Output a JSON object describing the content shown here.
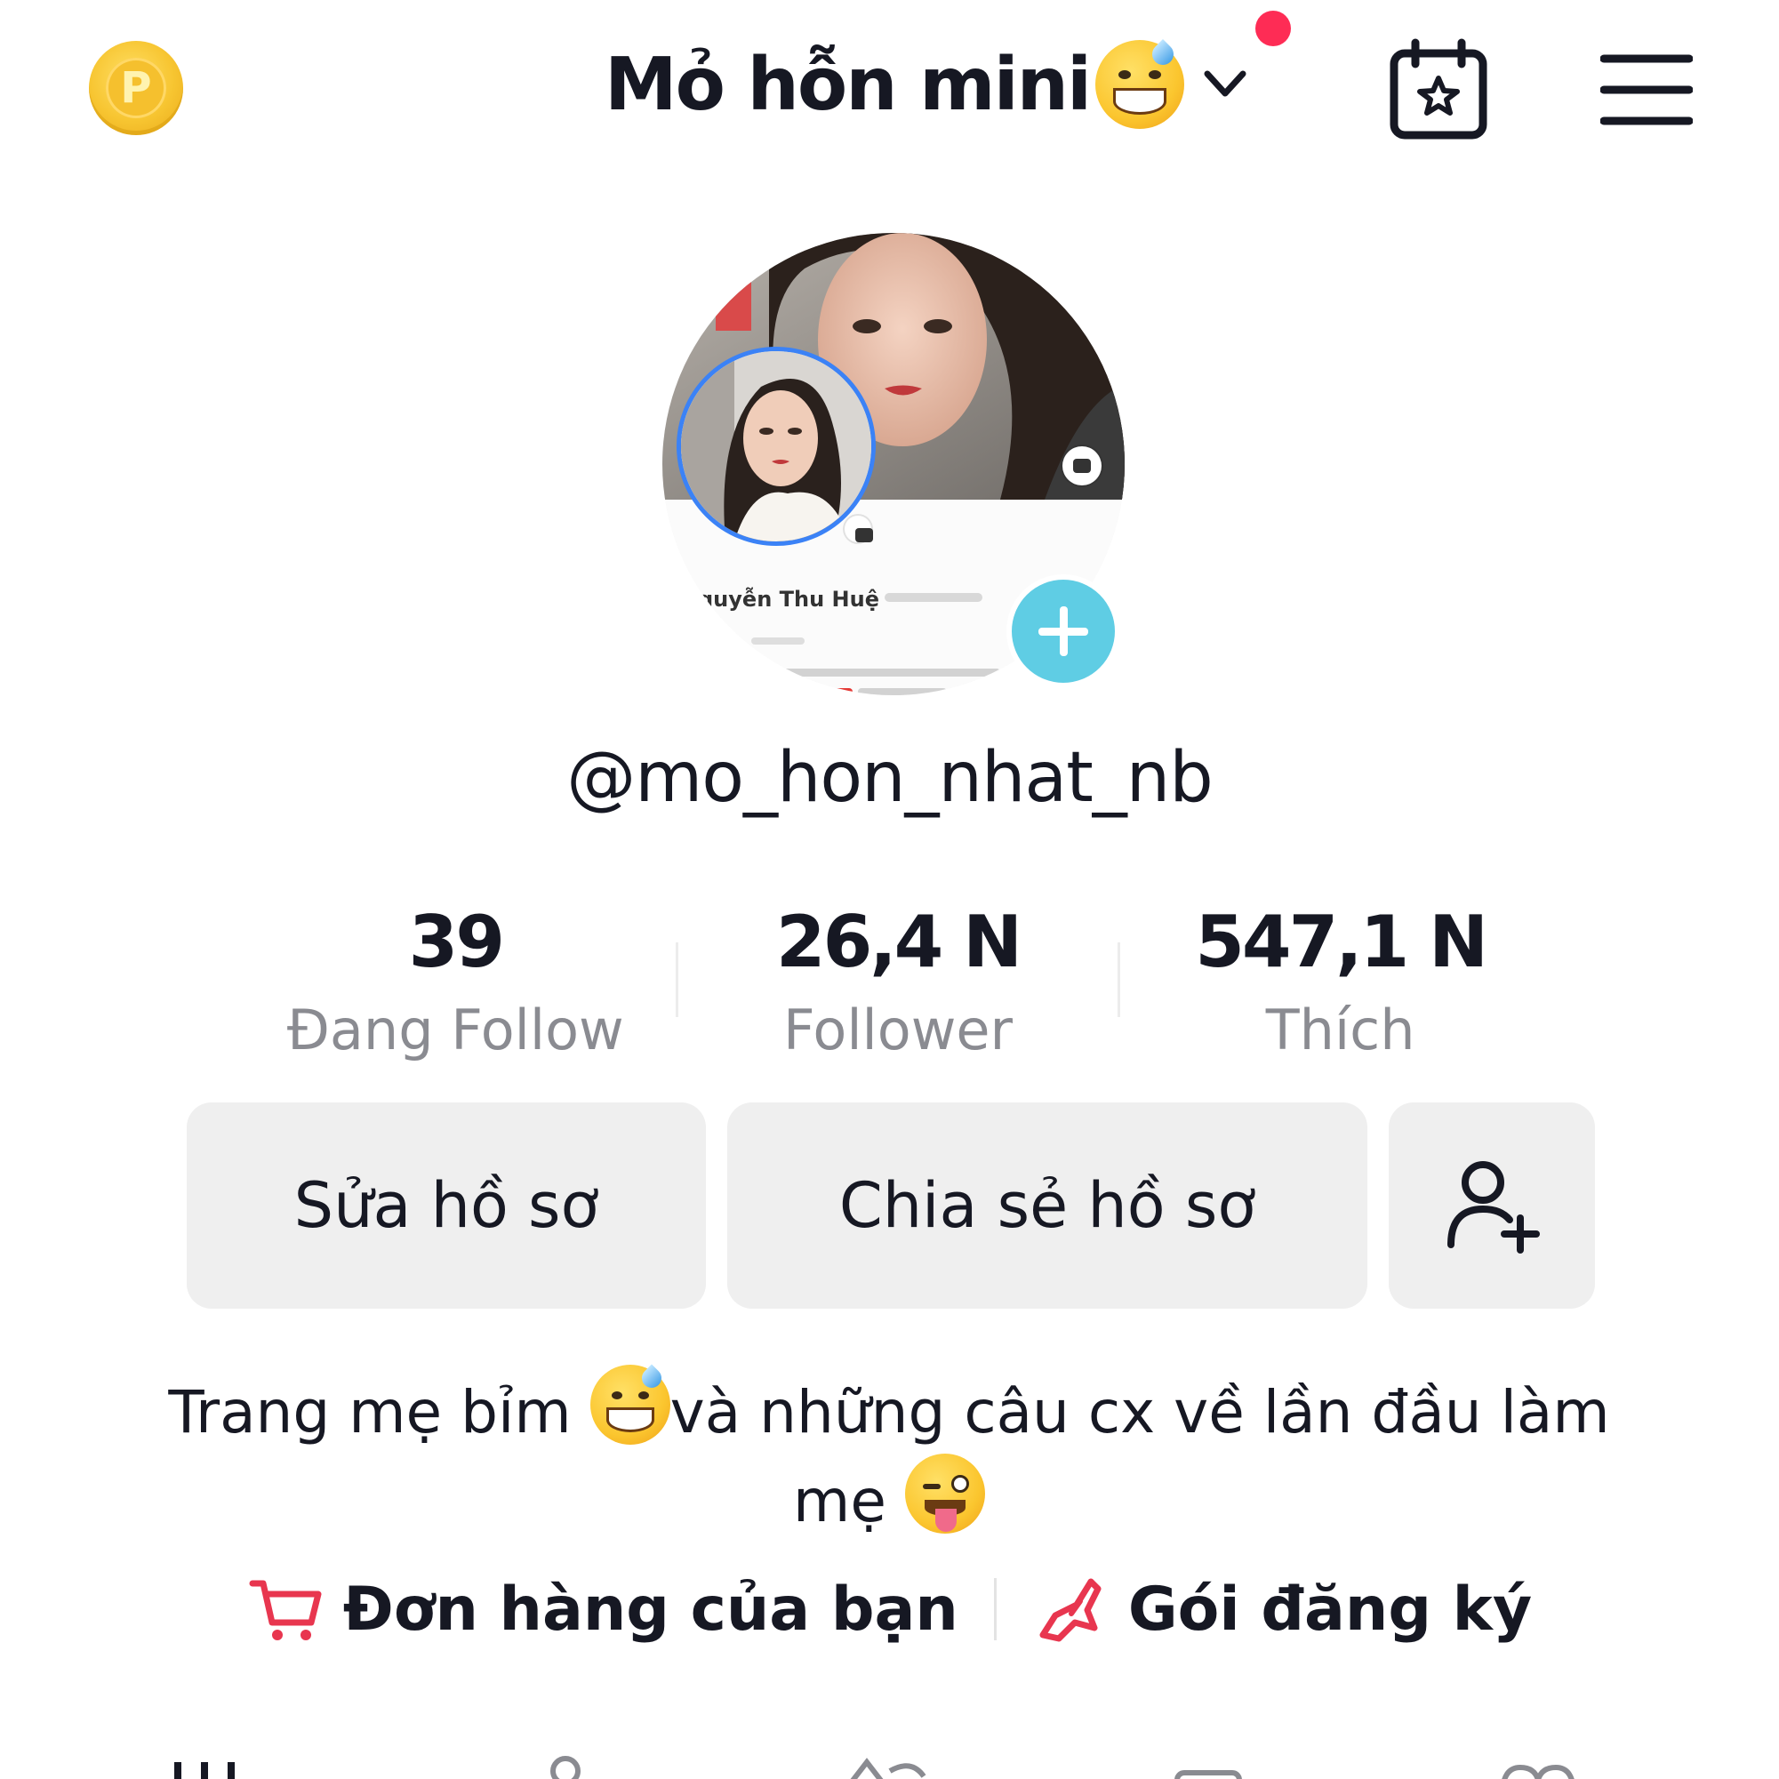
{
  "header": {
    "coin_letter": "P",
    "title": "Mỏ hỗn mini"
  },
  "profile": {
    "avatar_caption_name": "guyễn Thu Huệ",
    "handle": "@mo_hon_nhat_nb"
  },
  "stats": [
    {
      "value": "39",
      "label": "Đang Follow"
    },
    {
      "value": "26,4 N",
      "label": "Follower"
    },
    {
      "value": "547,1 N",
      "label": "Thích"
    }
  ],
  "buttons": {
    "edit_profile": "Sửa hồ sơ",
    "share_profile": "Chia sẻ hồ sơ"
  },
  "bio": {
    "part1": "Trang mẹ bỉm ",
    "part2": "và những câu cx về lần đầu làm mẹ "
  },
  "links": {
    "orders": "Đơn hàng của bạn",
    "subscriptions": "Gói đăng ký"
  },
  "icons": {
    "coin": "points-coin-icon",
    "calendar": "calendar-star-icon",
    "menu": "hamburger-menu-icon",
    "add_friend": "add-friend-icon",
    "cart": "cart-icon",
    "subscription": "subscription-icon"
  },
  "colors": {
    "accent_red": "#fe2c55",
    "add_button": "#5fcde4",
    "button_bg": "#efefef",
    "secondary_text": "#8a8b91",
    "link_icon": "#e8364f"
  }
}
